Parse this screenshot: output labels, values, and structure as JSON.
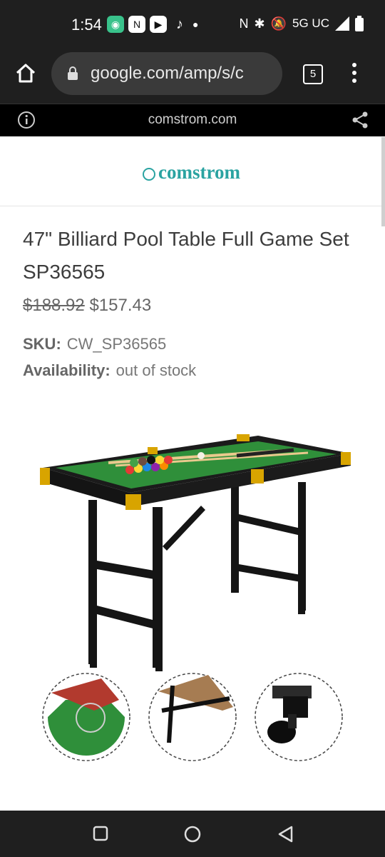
{
  "status": {
    "time": "1:54",
    "network": "5G UC",
    "apps": [
      "messages-icon",
      "nfl-app-icon",
      "youtube-icon",
      "tiktok-icon"
    ]
  },
  "browser": {
    "url": "google.com/amp/s/c",
    "tab_count": "5"
  },
  "amp": {
    "domain": "comstrom.com"
  },
  "site": {
    "logo": "comstrom"
  },
  "product": {
    "title": "47\" Billiard Pool Table Full Game Set SP36565",
    "old_price": "$188.92",
    "price": "$157.43",
    "sku_label": "SKU:",
    "sku_value": "CW_SP36565",
    "availability_label": "Availability:",
    "availability_value": "out of stock"
  },
  "colors": {
    "accent": "#2aa3a1",
    "felt": "#2f8f3a",
    "frame": "#1b1b1b"
  }
}
